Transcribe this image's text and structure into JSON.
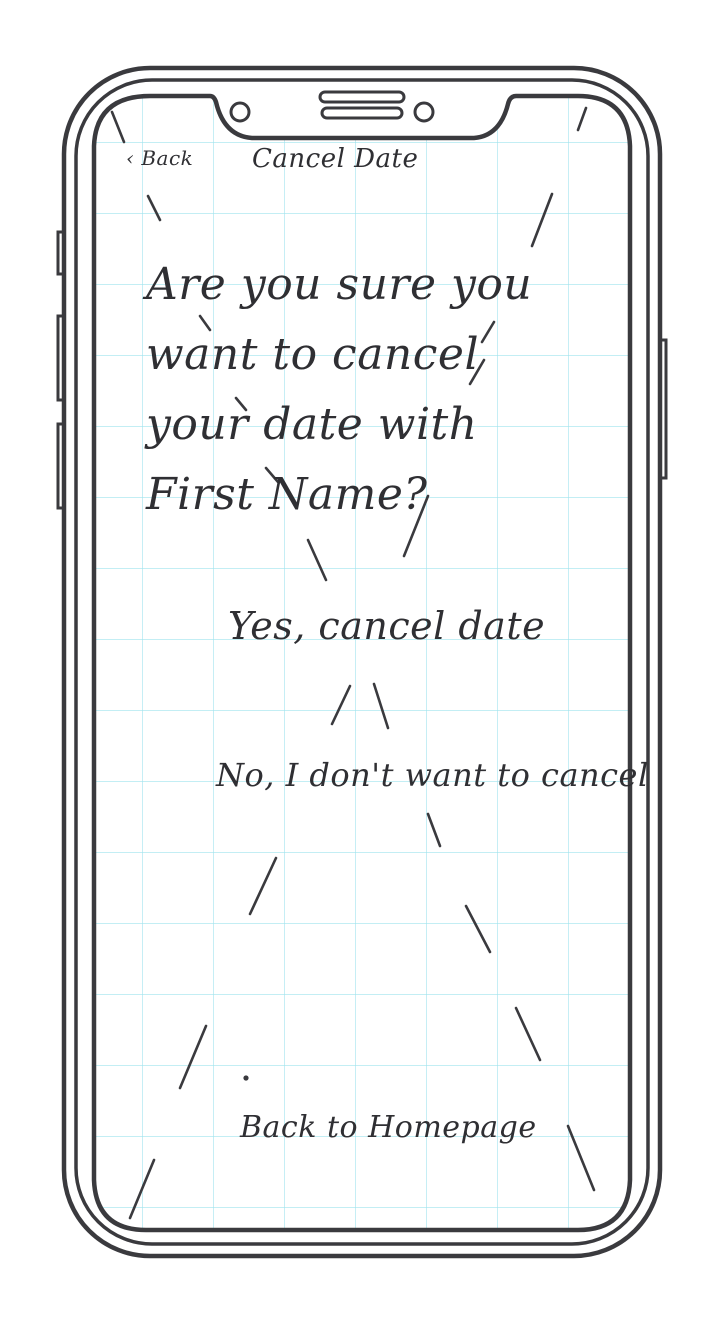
{
  "nav": {
    "back_label": "‹ Back",
    "title": "Cancel Date"
  },
  "dialog": {
    "question_lines": [
      "Are you sure you",
      "want to cancel",
      "your date with",
      "First Name?"
    ],
    "confirm_label": "Yes, cancel date",
    "decline_label": "No, I don't want to cancel"
  },
  "footer": {
    "home_label": "Back to Homepage"
  },
  "colors": {
    "ink": "#2f2f33",
    "grid": "#9fe3ee",
    "paper": "#ffffff"
  }
}
